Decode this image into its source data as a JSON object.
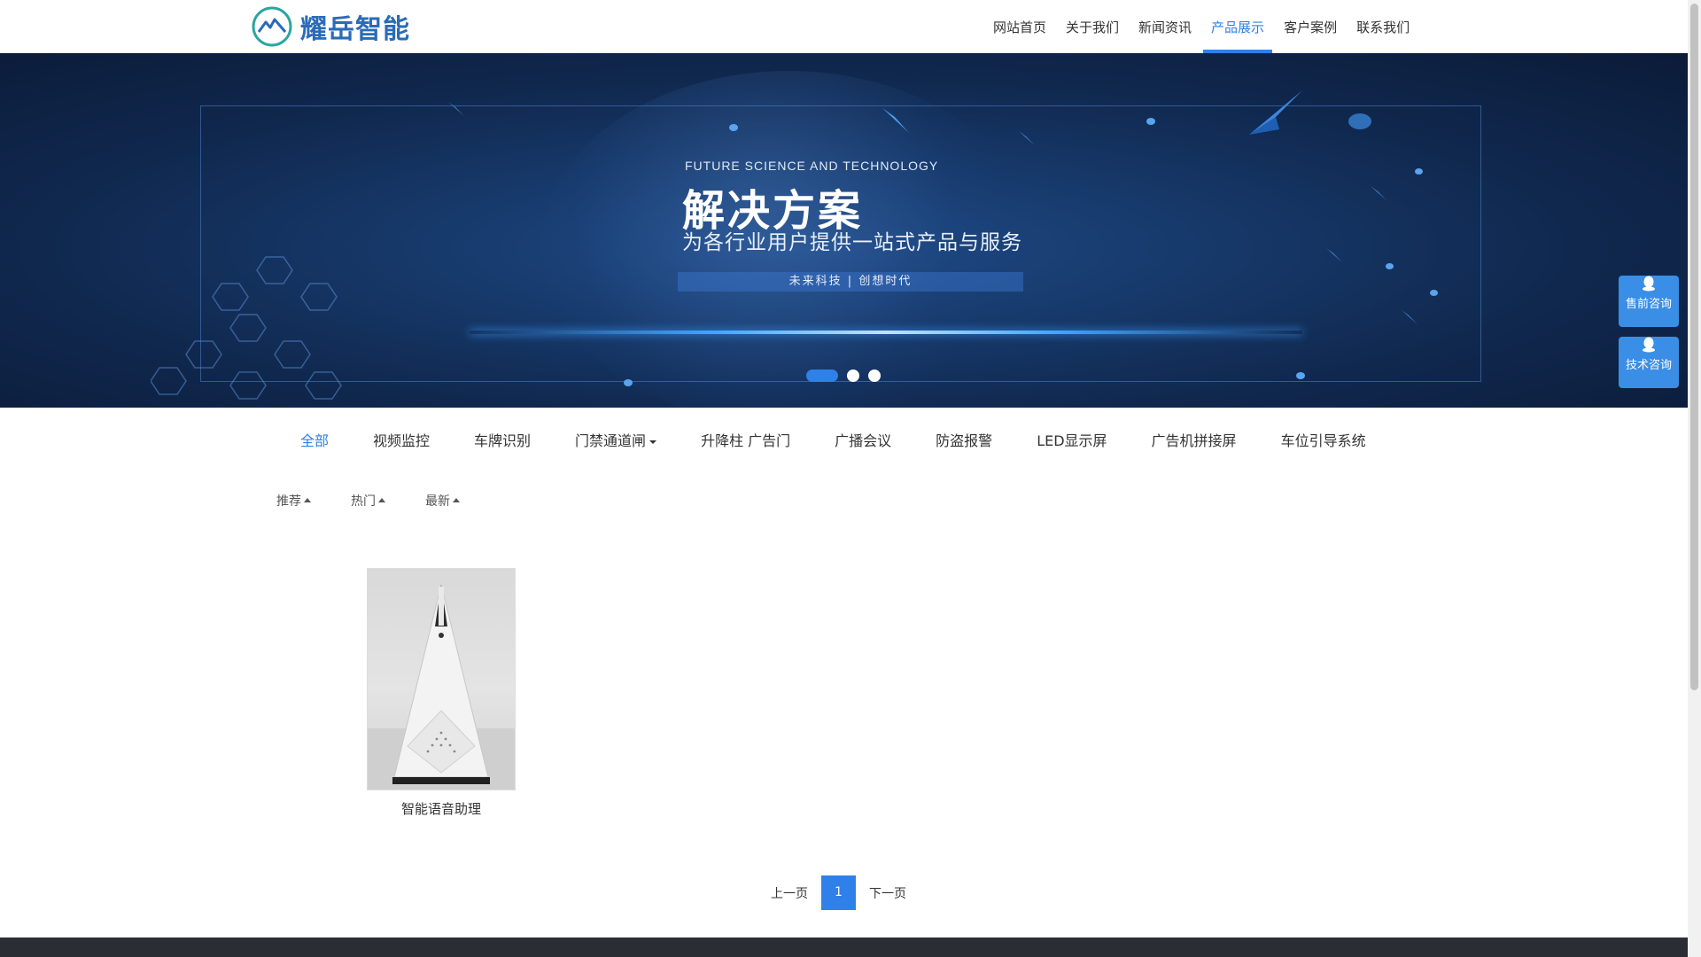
{
  "brand": {
    "name": "耀岳智能",
    "logo_icon": "mountain-logo-icon"
  },
  "nav": {
    "items": [
      {
        "label": "网站首页",
        "active": false
      },
      {
        "label": "关于我们",
        "active": false
      },
      {
        "label": "新闻资讯",
        "active": false
      },
      {
        "label": "产品展示",
        "active": true
      },
      {
        "label": "客户案例",
        "active": false
      },
      {
        "label": "联系我们",
        "active": false
      }
    ]
  },
  "banner": {
    "en_title": "FUTURE SCIENCE AND TECHNOLOGY",
    "title": "解决方案",
    "subtitle": "为各行业用户提供一站式产品与服务",
    "tag": "未来科技 | 创想时代",
    "slides": 3,
    "active_slide": 1
  },
  "side": {
    "presale": "售前咨询",
    "tech": "技术咨询",
    "icon": "qq-icon"
  },
  "categories": [
    {
      "label": "全部",
      "active": true
    },
    {
      "label": "视频监控"
    },
    {
      "label": "车牌识别"
    },
    {
      "label": "门禁通道闸",
      "dropdown": true
    },
    {
      "label": "升降柱 广告门"
    },
    {
      "label": "广播会议"
    },
    {
      "label": "防盗报警"
    },
    {
      "label": "LED显示屏"
    },
    {
      "label": "广告机拼接屏"
    },
    {
      "label": "车位引导系统"
    }
  ],
  "sorts": [
    "推荐",
    "热门",
    "最新"
  ],
  "products": [
    {
      "name": "智能语音助理"
    }
  ],
  "pagination": {
    "prev": "上一页",
    "current": "1",
    "next": "下一页"
  },
  "colors": {
    "accent": "#2f80e8",
    "banner_bg": "#10284e",
    "footer": "#2a2d33"
  }
}
